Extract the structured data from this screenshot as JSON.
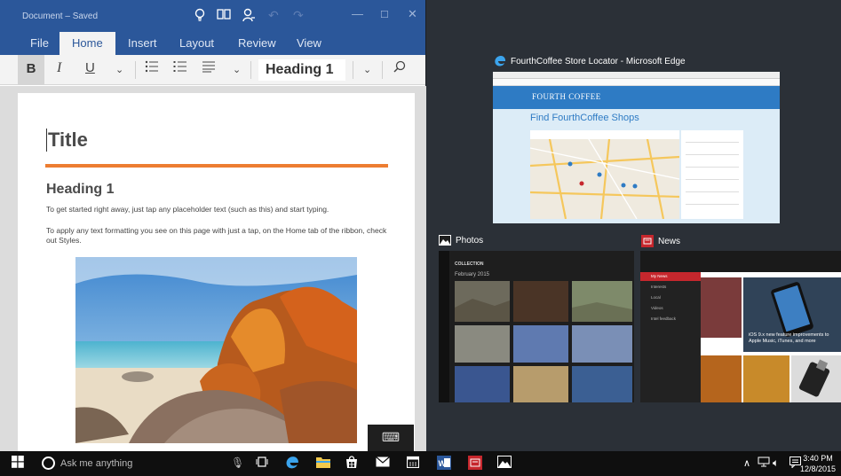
{
  "word": {
    "doc_status": "Document – Saved",
    "tabs": [
      "File",
      "Home",
      "Insert",
      "Layout",
      "Review",
      "View"
    ],
    "ribbon": {
      "bold": "B",
      "italic": "I",
      "underline": "U",
      "style_value": "Heading 1"
    },
    "page": {
      "title": "Title",
      "heading": "Heading 1",
      "para1": "To get started right away, just tap any placeholder text (such as this) and start typing.",
      "para2": "To apply any text formatting you see on this page with just a tap, on the Home tab of the ribbon, check out Styles."
    }
  },
  "task_view": {
    "edge": {
      "label": "FourthCoffee Store Locator - Microsoft Edge",
      "brand": "FOURTH COFFEE",
      "heading": "Find FourthCoffee Shops"
    },
    "photos": {
      "label": "Photos",
      "header": "COLLECTION",
      "section": "February 2015"
    },
    "news": {
      "label": "News",
      "menu": [
        "My News",
        "Interests",
        "Local",
        "Videos",
        "Intel feedback"
      ],
      "headline": "iOS 9.x new feature improvements to Apple Music, iTunes, and more"
    }
  },
  "taskbar": {
    "search_placeholder": "Ask me anything",
    "time": "3:40 PM",
    "date": "12/8/2015"
  },
  "colors": {
    "word_blue": "#2b579a",
    "accent_orange": "#ed7d31",
    "edge_blue": "#2e7bc4",
    "news_red": "#c6272d"
  }
}
